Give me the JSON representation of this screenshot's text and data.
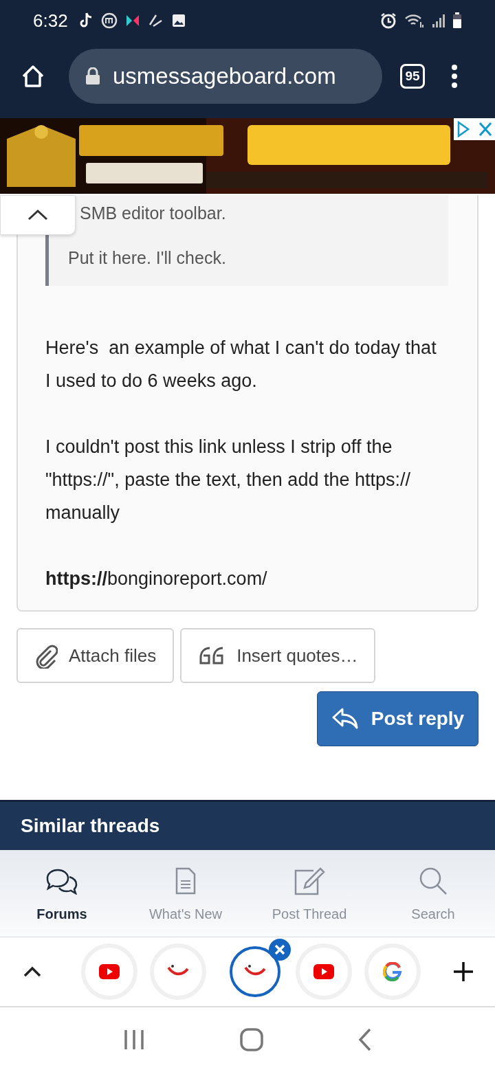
{
  "status_bar": {
    "time": "6:32"
  },
  "browser": {
    "url": "usmessageboard.com",
    "tab_count": "95"
  },
  "editor": {
    "quote_text": "SMB editor toolbar.",
    "nested_quote": "Put it here. I'll check.",
    "paragraphs": [
      "Here's  an example of what I can't do today that I used to do 6 weeks ago.",
      "I couldn't post this link unless I strip off the \"https://\", paste the text, then add the https:// manually",
      "**https://**bonginoreport.com/"
    ]
  },
  "actions": [
    {
      "kind": "attach",
      "label": "Attach files"
    },
    {
      "kind": "quote",
      "label": "Insert quotes…"
    }
  ],
  "submit": {
    "label": "Post reply"
  },
  "similar_threads": {
    "title": "Similar threads"
  },
  "bottom_nav": [
    {
      "kind": "forums",
      "label": "Forums",
      "selected": true
    },
    {
      "kind": "new",
      "label": "What's New",
      "selected": false
    },
    {
      "kind": "post",
      "label": "Post Thread",
      "selected": false
    },
    {
      "kind": "search",
      "label": "Search",
      "selected": false
    }
  ],
  "tab_strip": [
    {
      "kind": "video",
      "selected": false
    },
    {
      "kind": "smile",
      "selected": false
    },
    {
      "kind": "smile",
      "selected": true
    },
    {
      "kind": "video",
      "selected": false
    },
    {
      "kind": "google",
      "selected": false
    }
  ]
}
